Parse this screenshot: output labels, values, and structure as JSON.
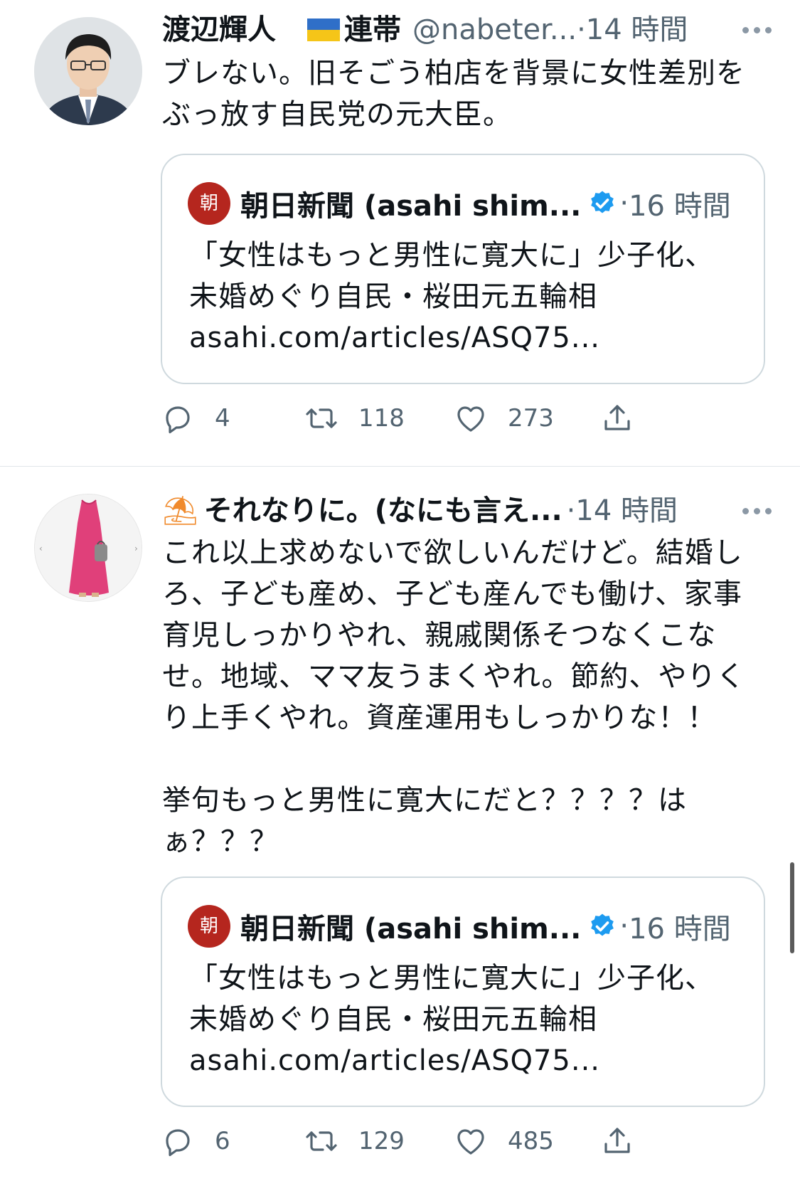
{
  "tweets": [
    {
      "display_name": "渡辺輝人",
      "flag_label": "連帯",
      "handle": "@nabeter...",
      "time": "14 時間",
      "lines": [
        "ブレない。旧そごう柏店を背景に女性差別を",
        "ぶっ放す自民党の元大臣。"
      ],
      "quote": {
        "logo_char": "朝",
        "name": "朝日新聞 (asahi shim...",
        "time": "16 時間",
        "lines": [
          "「女性はもっと男性に寛大に」少子化、",
          "未婚めぐり自民・桜田元五輪相",
          "asahi.com/articles/ASQ75..."
        ]
      },
      "stats": {
        "replies": "4",
        "retweets": "118",
        "likes": "273"
      }
    },
    {
      "emoji": "⛱",
      "display_name": "それなりに。(なにも言え...",
      "time": "14 時間",
      "lines": [
        "これ以上求めないで欲しいんだけど。結婚し",
        "ろ、子ども産め、子ども産んでも働け、家事",
        "育児しっかりやれ、親戚関係そつなくこな",
        "せ。地域、ママ友うまくやれ。節約、やりく",
        "り上手くやれ。資産運用もしっかりな！！",
        "",
        "挙句もっと男性に寛大にだと？？？？は",
        "ぁ？？？"
      ],
      "quote": {
        "logo_char": "朝",
        "name": "朝日新聞 (asahi shim...",
        "time": "16 時間",
        "lines": [
          "「女性はもっと男性に寛大に」少子化、",
          "未婚めぐり自民・桜田元五輪相",
          "asahi.com/articles/ASQ75..."
        ]
      },
      "stats": {
        "replies": "6",
        "retweets": "129",
        "likes": "485"
      }
    }
  ],
  "colors": {
    "verified": "#1d9bf0",
    "asahi_red": "#b5261e",
    "muted": "#536471",
    "border": "#cfd9de"
  },
  "icons": [
    "reply-icon",
    "retweet-icon",
    "like-icon",
    "share-icon",
    "more-icon",
    "verified-icon",
    "ukraine-flag-icon",
    "beach-umbrella-icon"
  ]
}
